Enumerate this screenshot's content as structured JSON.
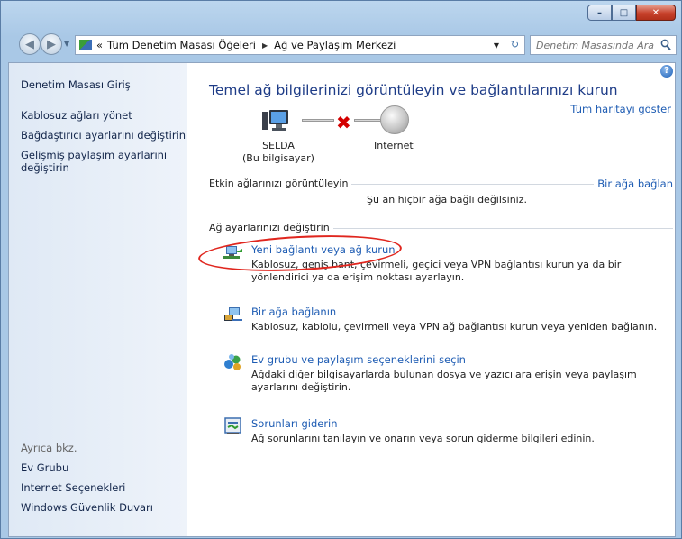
{
  "window": {
    "caption": {
      "minimize": "–",
      "maximize": "□",
      "close": "✕"
    }
  },
  "nav": {
    "breadcrumb_prefix": "«",
    "breadcrumbs": [
      "Tüm Denetim Masası Öğeleri",
      "Ağ ve Paylaşım Merkezi"
    ],
    "search_placeholder": "Denetim Masasında Ara"
  },
  "sidebar": {
    "home": "Denetim Masası Giriş",
    "links": [
      "Kablosuz ağları yönet",
      "Bağdaştırıcı ayarlarını değiştirin",
      "Gelişmiş paylaşım ayarlarını değiştirin"
    ],
    "see_also_title": "Ayrıca bkz.",
    "see_also": [
      "Ev Grubu",
      "Internet Seçenekleri",
      "Windows Güvenlik Duvarı"
    ]
  },
  "main": {
    "help": "?",
    "title": "Temel ağ bilgilerinizi görüntüleyin ve bağlantılarınızı kurun",
    "full_map": "Tüm haritayı göster",
    "map": {
      "computer_name": "SELDA",
      "computer_sub": "(Bu bilgisayar)",
      "internet": "Internet",
      "disconnected_mark": "✖"
    },
    "active_networks": {
      "label": "Etkin ağlarınızı görüntüleyin",
      "connect_link": "Bir ağa bağlan",
      "status": "Şu an hiçbir ağa bağlı değilsiniz."
    },
    "change_settings": {
      "label": "Ağ ayarlarınızı değiştirin",
      "tasks": [
        {
          "title": "Yeni bağlantı veya ağ kurun",
          "desc": "Kablosuz, geniş bant, çevirmeli, geçici veya VPN bağlantısı kurun ya da bir yönlendirici ya da erişim noktası ayarlayın."
        },
        {
          "title": "Bir ağa bağlanın",
          "desc": "Kablosuz, kablolu, çevirmeli veya VPN ağ bağlantısı kurun veya yeniden bağlanın."
        },
        {
          "title": "Ev grubu ve paylaşım seçeneklerini seçin",
          "desc": "Ağdaki diğer bilgisayarlarda bulunan dosya ve yazıcılara erişin veya paylaşım ayarlarını değiştirin."
        },
        {
          "title": "Sorunları giderin",
          "desc": "Ağ sorunlarını tanılayın ve onarın veya sorun giderme bilgileri edinin."
        }
      ]
    }
  },
  "colors": {
    "link": "#1e5cb3",
    "title": "#1e3c87",
    "annotation": "#e0261e"
  }
}
